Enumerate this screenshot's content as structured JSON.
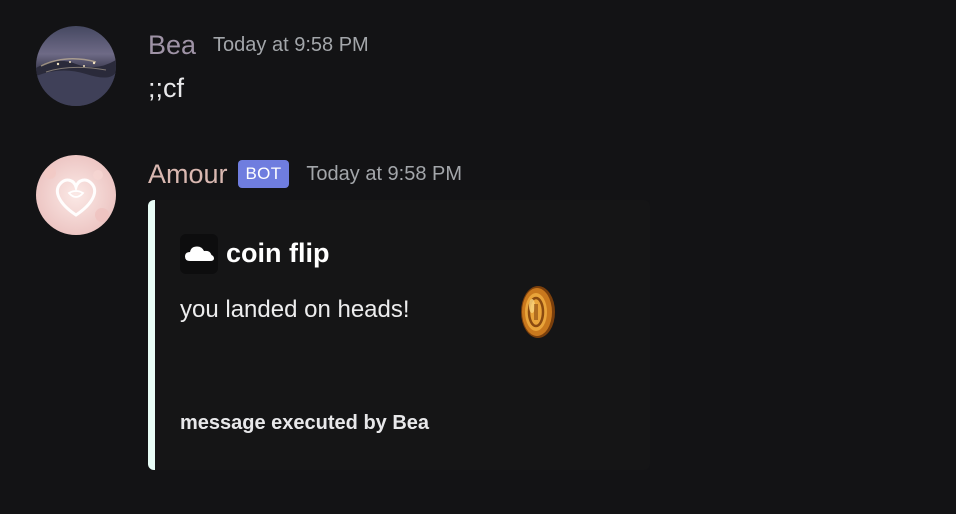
{
  "messages": [
    {
      "author": "Bea",
      "timestamp": "Today at 9:58 PM",
      "content": ";;cf"
    },
    {
      "author": "Amour",
      "badge": "BOT",
      "timestamp": "Today at 9:58 PM",
      "embed": {
        "author_icon": "cloud-icon",
        "title": "coin flip",
        "description": "you landed on heads!",
        "thumbnail": "gold-coin-icon",
        "footer": "message executed by Bea",
        "accent_color": "#e8fcf6"
      }
    }
  ],
  "colors": {
    "background": "#131315",
    "bea_name": "#9f93a6",
    "amour_name": "#d9b8b1",
    "bot_badge": "#6f7ddf",
    "timestamp": "#a3a6aa"
  }
}
